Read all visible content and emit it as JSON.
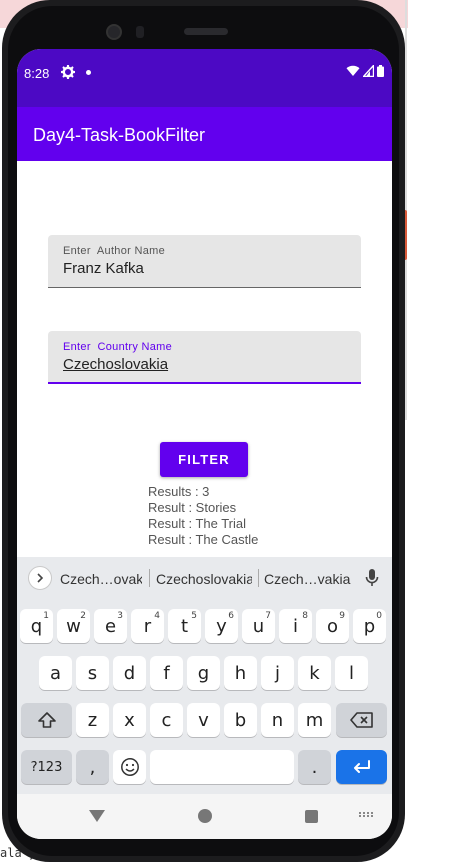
{
  "status_bar": {
    "time": "8:28"
  },
  "app_bar": {
    "title": "Day4-Task-BookFilter"
  },
  "author_field": {
    "label": "Enter  Author Name",
    "value": "Franz Kafka"
  },
  "country_field": {
    "label": "Enter  Country Name",
    "value": "Czechoslovakia"
  },
  "filter_button": {
    "label": "FILTER"
  },
  "results": {
    "count_line": "Results : 3",
    "items": [
      "Result : Stories",
      "Result : The Trial",
      "Result : The Castle"
    ]
  },
  "keyboard": {
    "suggestions": [
      "Czech…ovakia",
      "Czechoslovakia l",
      "Czech…vakia a"
    ],
    "row1": [
      {
        "key": "q",
        "hint": "1"
      },
      {
        "key": "w",
        "hint": "2"
      },
      {
        "key": "e",
        "hint": "3"
      },
      {
        "key": "r",
        "hint": "4"
      },
      {
        "key": "t",
        "hint": "5"
      },
      {
        "key": "y",
        "hint": "6"
      },
      {
        "key": "u",
        "hint": "7"
      },
      {
        "key": "i",
        "hint": "8"
      },
      {
        "key": "o",
        "hint": "9"
      },
      {
        "key": "p",
        "hint": "0"
      }
    ],
    "row2": [
      "a",
      "s",
      "d",
      "f",
      "g",
      "h",
      "j",
      "k",
      "l"
    ],
    "row3": [
      "z",
      "x",
      "c",
      "v",
      "b",
      "n",
      "m"
    ],
    "symbols_key": "?123",
    "comma_key": ",",
    "period_key": "."
  },
  "background": {
    "corner_text": "ala y"
  },
  "colors": {
    "primary": "#6200ee",
    "status_bar": "#4c09c4",
    "enter_key": "#1a73e8"
  },
  "icons": [
    "settings-gear-icon",
    "notification-dot-icon",
    "wifi-icon",
    "signal-icon",
    "battery-icon",
    "chevron-right-icon",
    "microphone-icon",
    "shift-icon",
    "backspace-icon",
    "emoji-icon",
    "enter-icon",
    "nav-back-icon",
    "nav-home-icon",
    "nav-recents-icon",
    "keyboard-switch-icon"
  ]
}
